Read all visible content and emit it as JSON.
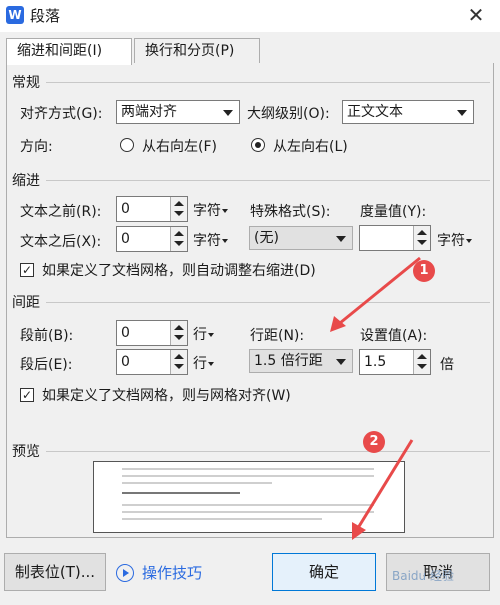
{
  "window": {
    "title": "段落",
    "app_icon_letter": "W"
  },
  "tabs": [
    {
      "label": "缩进和间距(I)",
      "active": true
    },
    {
      "label": "换行和分页(P)",
      "active": false
    }
  ],
  "general": {
    "title": "常规",
    "alignment": {
      "label": "对齐方式(G):",
      "value": "两端对齐"
    },
    "outline": {
      "label": "大纲级别(O):",
      "value": "正文文本"
    },
    "direction": {
      "label": "方向:",
      "rtl": "从右向左(F)",
      "ltr": "从左向右(L)",
      "selected": "ltr"
    }
  },
  "indent": {
    "title": "缩进",
    "before": {
      "label": "文本之前(R):",
      "value": "0",
      "unit": "字符"
    },
    "after": {
      "label": "文本之后(X):",
      "value": "0",
      "unit": "字符"
    },
    "special": {
      "label": "特殊格式(S):",
      "value": "(无)"
    },
    "measure": {
      "label": "度量值(Y):",
      "value": "",
      "unit": "字符"
    },
    "auto_adjust": {
      "label": "如果定义了文档网格，则自动调整右缩进(D)",
      "checked": true
    }
  },
  "spacing": {
    "title": "间距",
    "before": {
      "label": "段前(B):",
      "value": "0",
      "unit": "行"
    },
    "after": {
      "label": "段后(E):",
      "value": "0",
      "unit": "行"
    },
    "line_spacing": {
      "label": "行距(N):",
      "value": "1.5 倍行距"
    },
    "set_value": {
      "label": "设置值(A):",
      "value": "1.5",
      "unit": "倍"
    },
    "snap_grid": {
      "label": "如果定义了文档网格，则与网格对齐(W)",
      "checked": true
    }
  },
  "preview": {
    "title": "预览"
  },
  "buttons": {
    "tabs": "制表位(T)...",
    "help": "操作技巧",
    "ok": "确定",
    "cancel": "取消"
  },
  "annotations": {
    "badge1": "1",
    "badge2": "2",
    "arrow_color": "#e84a4a"
  },
  "colors": {
    "accent": "#2a6ae0",
    "primary_border": "#0078d7",
    "badge": "#e84a4a"
  },
  "watermark": "Baidu 经验"
}
